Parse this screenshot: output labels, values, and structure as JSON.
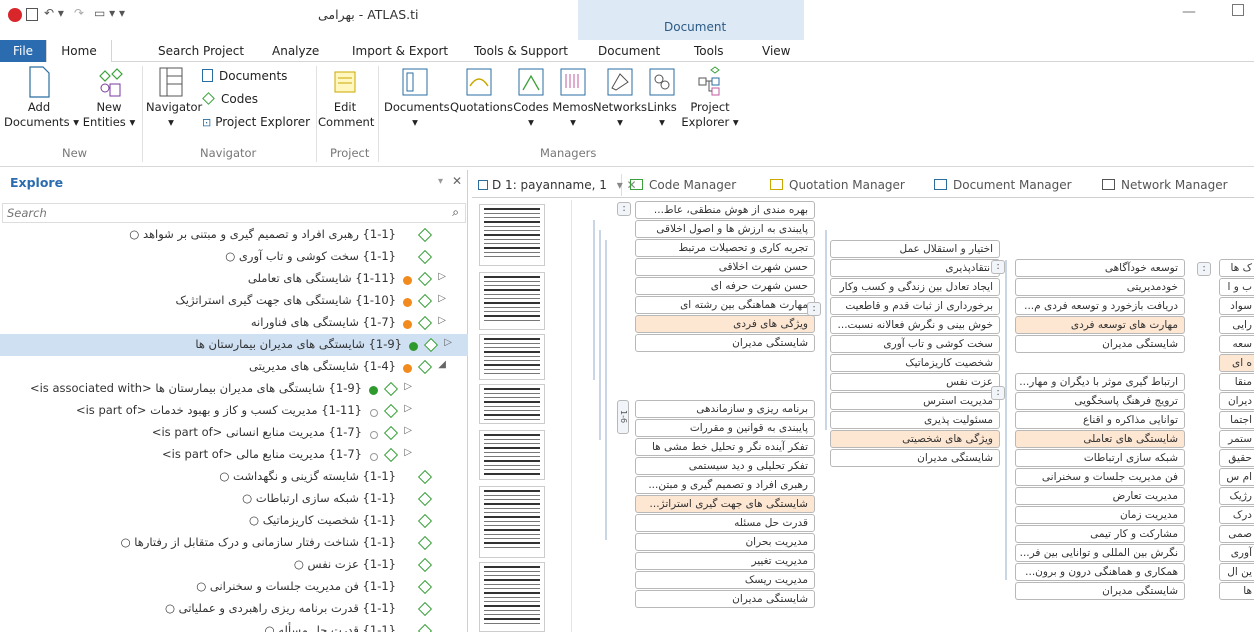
{
  "titlebar": {
    "title": "بهرامی - ATLAS.ti",
    "context_group": "Document",
    "quick_icons": [
      "atlas-logo-icon",
      "save-icon",
      "undo-icon",
      "redo-icon",
      "menu-icon"
    ]
  },
  "ribbon_tabs": [
    "File",
    "Home",
    "Search Project",
    "Analyze",
    "Import & Export",
    "Tools & Support",
    "Document",
    "Tools",
    "View"
  ],
  "ribbon": {
    "add_documents": [
      "Add",
      "Documents ▾"
    ],
    "new_entities": [
      "New",
      "Entities ▾"
    ],
    "group_new": "New",
    "navigator": "Navigator",
    "navigator_caret": "▾",
    "nav_documents": "Documents",
    "nav_codes": "Codes",
    "nav_project_explorer": "Project Explorer",
    "group_navigator": "Navigator",
    "edit_comment": [
      "Edit",
      "Comment"
    ],
    "group_project": "Project",
    "managers": [
      {
        "label": "Documents",
        "caret": "▾"
      },
      {
        "label": "Quotations",
        "caret": ""
      },
      {
        "label": "Codes",
        "caret": "▾"
      },
      {
        "label": "Memos",
        "caret": "▾"
      },
      {
        "label": "Networks",
        "caret": "▾"
      },
      {
        "label": "Links",
        "caret": "▾"
      }
    ],
    "project_explorer": [
      "Project",
      "Explorer ▾"
    ],
    "group_managers": "Managers"
  },
  "explore": {
    "title": "Explore",
    "pin": "▾",
    "close": "✕",
    "search_placeholder": "Search",
    "rows": [
      {
        "text": "{1-1} رهبری افراد و تصمیم گیری و مبتنی بر شواهد ○",
        "indent": 0,
        "expand": "",
        "dot": "",
        "color": "#999",
        "sel": false
      },
      {
        "text": "{1-1} سخت کوشی و تاب آوری ○",
        "indent": 0,
        "expand": "",
        "dot": "",
        "color": "#999",
        "sel": false
      },
      {
        "text": "{1-11} شایستگی های تعاملی",
        "indent": 0,
        "expand": "▷",
        "dot": "dot",
        "color": "#f28a1e",
        "sel": false
      },
      {
        "text": "{1-10} شایستگی های جهت گیری استراتژیک",
        "indent": 0,
        "expand": "▷",
        "dot": "dot",
        "color": "#f28a1e",
        "sel": false
      },
      {
        "text": "{1-7} شایستگی های فناورانه",
        "indent": 0,
        "expand": "▷",
        "dot": "dot",
        "color": "#f28a1e",
        "sel": false
      },
      {
        "text": "{1-9} شایستگی های مدیران بیمارستان ها",
        "indent": 0,
        "expand": "▷",
        "dot": "dot",
        "color": "#2e9a2e",
        "sel": true
      },
      {
        "text": "{1-4} شایستگی های مدیریتی",
        "indent": 0,
        "expand": "◢",
        "dot": "dot",
        "color": "#f28a1e",
        "sel": false
      },
      {
        "text": "{1-9} شایستگی های مدیران بیمارستان ها <is associated with>",
        "indent": 1,
        "expand": "▷",
        "dot": "dot",
        "color": "#2e9a2e",
        "sel": false
      },
      {
        "text": "{1-11} مدیریت کسب و کاز و بهبود خدمات <is part of>",
        "indent": 1,
        "expand": "▷",
        "dot": "ring",
        "color": "#999",
        "sel": false
      },
      {
        "text": "{1-7} مدیریت منابع انسانی <is part of>",
        "indent": 1,
        "expand": "▷",
        "dot": "ring",
        "color": "#999",
        "sel": false
      },
      {
        "text": "{1-7} مدیریت منابع مالی <is part of>",
        "indent": 1,
        "expand": "▷",
        "dot": "ring",
        "color": "#999",
        "sel": false
      },
      {
        "text": "{1-1} شایسته گزینی و نگهداشت ○",
        "indent": 0,
        "expand": "",
        "dot": "",
        "color": "#999",
        "sel": false
      },
      {
        "text": "{1-1} شبکه سازی ارتباطات ○",
        "indent": 0,
        "expand": "",
        "dot": "",
        "color": "#999",
        "sel": false
      },
      {
        "text": "{1-1} شخصیت کاریزماتیک ○",
        "indent": 0,
        "expand": "",
        "dot": "",
        "color": "#999",
        "sel": false
      },
      {
        "text": "{1-1} شناخت رفتار سازمانی و درک متقابل از رفتارها ○",
        "indent": 0,
        "expand": "",
        "dot": "",
        "color": "#999",
        "sel": false
      },
      {
        "text": "{1-1} عزت نفس ○",
        "indent": 0,
        "expand": "",
        "dot": "",
        "color": "#999",
        "sel": false
      },
      {
        "text": "{1-1} فن مدیریت جلسات و سخنرانی ○",
        "indent": 0,
        "expand": "",
        "dot": "",
        "color": "#999",
        "sel": false
      },
      {
        "text": "{1-1} قدرت برنامه ریزی راهبردی و عملیاتی ○",
        "indent": 0,
        "expand": "",
        "dot": "",
        "color": "#999",
        "sel": false
      },
      {
        "text": "{1-1} قدرت حل مسأله ○",
        "indent": 0,
        "expand": "",
        "dot": "",
        "color": "#999",
        "sel": false
      }
    ]
  },
  "doc_tabs": [
    {
      "label": "D 1: payanname, 1",
      "extra": "▾ ✕",
      "active": true
    },
    {
      "label": "Code Manager",
      "extra": "",
      "active": false
    },
    {
      "label": "Quotation Manager",
      "extra": "",
      "active": false
    },
    {
      "label": "Document Manager",
      "extra": "",
      "active": false
    },
    {
      "label": "Network Manager",
      "extra": "",
      "active": false
    }
  ],
  "codes": {
    "col1_top": [
      "بهره مندی از هوش منطقی، عاط...",
      "پایبندی به ارزش ها و اصول اخلاقی",
      "تجربه کاری و تحصیلات مرتبط",
      "حسن شهرت اخلاقی",
      "حسن شهرت حرفه ای",
      "مهارت هماهنگی بین رشته ای",
      "ویژگی های فردی",
      "شایستگی مدیران"
    ],
    "col1_bottom": [
      "برنامه ریزی و سازماندهی",
      "پایبندی به قوانین و مقررات",
      "تفکر آینده نگر و تحلیل خط مشی ها",
      "تفکر تحلیلی و دید سیستمی",
      "رهبری افراد و تصمیم گیری و مبتن...",
      "شایستگی های جهت گیری استراتژ...",
      "قدرت حل مسئله",
      "مدیریت بحران",
      "مدیریت تغییر",
      "مدیریت ریسک",
      "شایستگی مدیران"
    ],
    "col2": [
      "اختیار و استقلال عمل",
      "انتقادپذیری",
      "ایجاد تعادل بین زندگی و کسب وکار",
      "برخورداری از ثبات قدم و قاطعیت",
      "خوش بینی و نگرش فعالانه نسبت...",
      "سخت کوشی و تاب آوری",
      "شخصیت کاریزماتیک",
      "عزت نفس",
      "مدیریت استرس",
      "مسئولیت پذیری",
      "ویژگی های شخصیتی",
      "شایستگی مدیران"
    ],
    "col3_top": [
      "توسعه خودآگاهی",
      "خودمدیریتی",
      "دریافت بازخورد و توسعه فردی م...",
      "مهارت های توسعه فردی",
      "شایستگی مدیران"
    ],
    "col3_bottom": [
      "ارتباط گیری موثر با دیگران و مهار...",
      "ترویج فرهنگ پاسخگویی",
      "توانایی مذاکره و اقناع",
      "شایستگی های تعاملی",
      "شبکه سازی ارتباطات",
      "فن مدیریت جلسات و سخنرانی",
      "مدیریت تعارض",
      "مدیریت زمان",
      "مشارکت و کار تیمی",
      "نگرش بین المللی و توانایی بین فر...",
      "همکاری و هماهنگی درون و برون...",
      "شایستگی مدیران"
    ],
    "col4": [
      "ک ها",
      "ب و ا",
      "سواد",
      "رایی",
      "سعه",
      "ه ای",
      "منقا",
      "دیران",
      "اجتما",
      "ستمر",
      "حقیق",
      "ام س",
      "رژیک",
      "درک",
      "صمی",
      "آوری",
      "ین ال",
      "ها"
    ],
    "pill_sym": ":",
    "rot_label": "1-6"
  }
}
